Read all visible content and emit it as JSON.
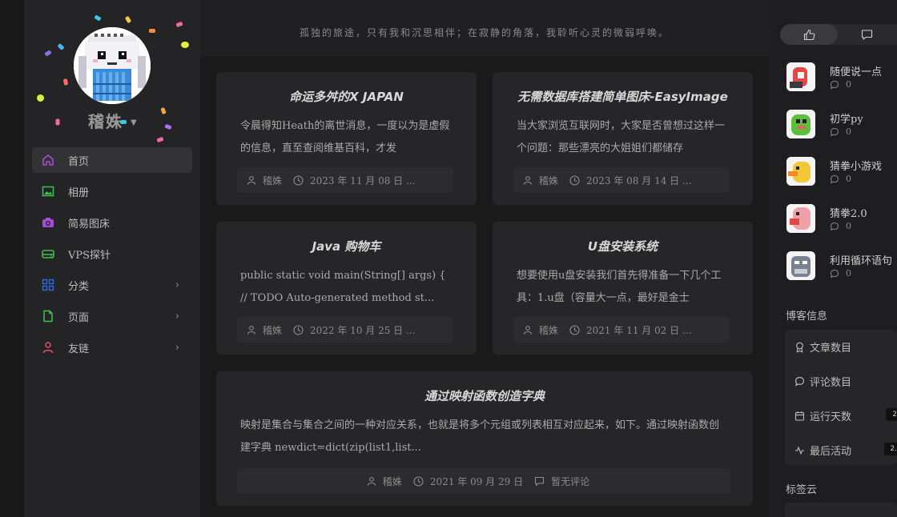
{
  "user": {
    "name": "稽姝"
  },
  "nav": [
    {
      "label": "首页",
      "icon": "home-icon",
      "active": true
    },
    {
      "label": "相册",
      "icon": "image-icon"
    },
    {
      "label": "简易图床",
      "icon": "camera-icon"
    },
    {
      "label": "VPS探针",
      "icon": "server-icon"
    },
    {
      "label": "分类",
      "icon": "grid-icon",
      "has_children": true
    },
    {
      "label": "页面",
      "icon": "file-icon",
      "has_children": true
    },
    {
      "label": "友链",
      "icon": "person-icon",
      "has_children": true
    }
  ],
  "header": {
    "motto": "孤独的旅途，只有我和沉思相伴；在寂静的角落，我聆听心灵的微弱呼唤。"
  },
  "posts": [
    {
      "title": "命运多舛的X JAPAN",
      "excerpt": "令晨得知Heath的离世消息，一度以为是虚假的信息，直至查阅维基百科，才发",
      "author": "稽姝",
      "date": "2023 年 11 月 08 日 ..."
    },
    {
      "title": "无需数据库搭建简单图床-EasyImage",
      "excerpt": "当大家浏览互联网时，大家是否曾想过这样一个问题：那些漂亮的大姐姐们都储存",
      "author": "稽姝",
      "date": "2023 年 08 月 14 日 ..."
    },
    {
      "title": "Java 购物车",
      "excerpt": "public static void main(String[] args) { // TODO Auto-generated method st...",
      "author": "稽姝",
      "date": "2022 年 10 月 25 日 ..."
    },
    {
      "title": "U盘安装系统",
      "excerpt": "想要使用u盘安装我们首先得准备一下几个工具：1.u盘（容量大一点，最好是金士",
      "author": "稽姝",
      "date": "2021 年 11 月 02 日 ..."
    },
    {
      "title": "通过映射函数创造字典",
      "excerpt": "映射是集合与集合之间的一种对应关系，也就是将多个元组或列表相互对应起来，如下。通过映射函数创建字典 newdict=dict(zip(list1,list...",
      "author": "稽姝",
      "date": "2021 年 09 月 29 日",
      "comments": "暂无评论"
    }
  ],
  "recent": [
    {
      "title": "随便说一点",
      "comments": "0"
    },
    {
      "title": "初学py",
      "comments": "0"
    },
    {
      "title": "猜拳小游戏",
      "comments": "0"
    },
    {
      "title": "猜拳2.0",
      "comments": "0"
    },
    {
      "title": "利用循环语句",
      "comments": "0"
    }
  ],
  "blog_info": {
    "title": "博客信息",
    "items": [
      {
        "label": "文章数目",
        "icon": "award-icon"
      },
      {
        "label": "评论数目",
        "icon": "comment-icon"
      },
      {
        "label": "运行天数",
        "icon": "calendar-icon",
        "value": "2"
      },
      {
        "label": "最后活动",
        "icon": "activity-icon",
        "value": "2."
      }
    ]
  },
  "tag_cloud": {
    "title": "标签云"
  },
  "colors": {
    "accent_purple": "#a64bd6",
    "accent_green": "#3ec24b",
    "accent_blue": "#2f66d8",
    "accent_red": "#e0506a"
  }
}
